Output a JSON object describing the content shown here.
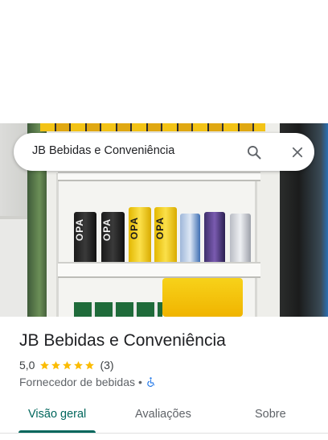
{
  "search": {
    "query": "JB Bebidas e Conveniência"
  },
  "place": {
    "name": "JB Bebidas e Conveniência",
    "rating": "5,0",
    "stars": 5,
    "review_count": "(3)",
    "category": "Fornecedor de bebidas",
    "separator": "•",
    "accessibility_icon": "wheelchair-accessible-icon"
  },
  "photo": {
    "can_brand": "OPA"
  },
  "tabs": [
    {
      "label": "Visão geral",
      "active": true
    },
    {
      "label": "Avaliações",
      "active": false
    },
    {
      "label": "Sobre",
      "active": false
    }
  ],
  "colors": {
    "accent": "#01665c",
    "star": "#fbbc04",
    "accessibility": "#1a73e8"
  }
}
